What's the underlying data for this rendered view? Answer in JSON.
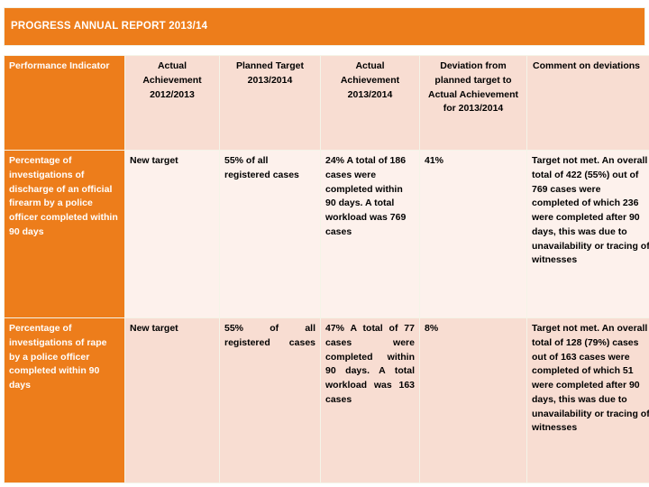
{
  "slide": {
    "title": "PROGRESS ANNUAL REPORT 2013/14",
    "accent_color": "#ED7D1B",
    "header_cell_color": "#F8DDD2",
    "row1_cell_color": "#FDF1EC",
    "row2_cell_color": "#F8DDD2",
    "title_text_color": "#FFFFFF"
  },
  "table": {
    "columns": [
      {
        "label": "Performance Indicator",
        "style": "indicator"
      },
      {
        "label": "Actual Achievement 2012/2013",
        "style": "plain"
      },
      {
        "label": "Planned Target 2013/2014",
        "style": "plain"
      },
      {
        "label": "Actual Achievement 2013/2014",
        "style": "plain"
      },
      {
        "label": "Deviation from planned target to Actual Achievement for 2013/2014",
        "style": "plain"
      },
      {
        "label": "Comment on deviations",
        "style": "plain-left"
      }
    ],
    "rows": [
      {
        "indicator": "Percentage of investigations of discharge of an official firearm by a police officer completed within 90 days",
        "actual_achievement_2012_2013": "New target",
        "planned_target_2013_2014": "55% of all registered cases",
        "actual_achievement_2013_2014": "24%\nA total of 186 cases were completed within 90 days. A total workload was 769 cases",
        "deviation": "41%",
        "comment": "Target not met.\nAn overall total of 422 (55%) out of 769 cases were completed of which 236 were completed after 90 days, this was due to unavailability or tracing of witnesses"
      },
      {
        "indicator": "Percentage of investigations of rape by a police officer completed within 90 days",
        "actual_achievement_2012_2013": "New target",
        "planned_target_2013_2014": "55% of all registered cases",
        "actual_achievement_2013_2014": "47%\nA total of 77 cases were completed within 90 days. A total workload was 163 cases",
        "deviation": "8%",
        "comment": "Target not met.\nAn overall total of 128 (79%) cases out of 163 cases were completed of which 51 were completed after 90 days, this was due to unavailability or tracing of witnesses"
      }
    ]
  }
}
